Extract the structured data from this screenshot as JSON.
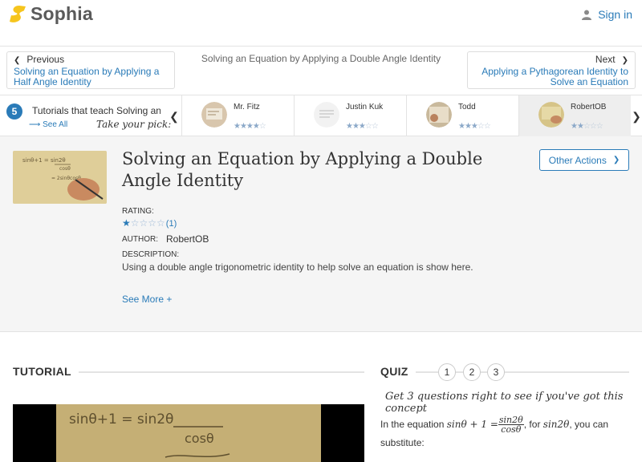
{
  "header": {
    "brand": "Sophia",
    "signin_label": "Sign in"
  },
  "nav": {
    "prev_head": "Previous",
    "prev_link": "Solving an Equation by Applying a Half Angle Identity",
    "current_title": "Solving an Equation by Applying a Double Angle Identity",
    "next_head": "Next",
    "next_link": "Applying a Pythagorean Identity to Solve an Equation"
  },
  "strip": {
    "count": "5",
    "label": "Tutorials that teach Solving an E",
    "see_all": "See All",
    "pick": "Take your pick:",
    "cards": [
      {
        "name": "Mr. Fitz",
        "stars": "3.5"
      },
      {
        "name": "Justin Kuk",
        "stars": "3"
      },
      {
        "name": "Todd",
        "stars": "3"
      },
      {
        "name": "RobertOB",
        "stars": "2"
      }
    ]
  },
  "info": {
    "title": "Solving an Equation by Applying a Double Angle Identity",
    "other_actions": "Other Actions",
    "rating_label": "RATING:",
    "rating_count": "(1)",
    "author_label": "AUTHOR:",
    "author": "RobertOB",
    "description_label": "DESCRIPTION:",
    "description": "Using a double angle trigonometric identity to help solve an equation is show here.",
    "see_more": "See More +"
  },
  "tutorial": {
    "heading": "TUTORIAL",
    "video_line1": "sinθ+1 = sin2θ",
    "video_line2": "cosθ"
  },
  "quiz": {
    "heading": "QUIZ",
    "numbers": [
      "1",
      "2",
      "3"
    ],
    "subtitle": "Get 3 questions right to see if you've got this concept",
    "q_prefix": "In the equation",
    "q_lhs": "sinθ + 1 =",
    "q_frac_num": "sin2θ",
    "q_frac_den": "cosθ",
    "q_mid": ", for",
    "q_term": "sin2θ",
    "q_suffix": ", you can substitute:"
  },
  "colors": {
    "accent": "#2a7bb8",
    "logo_yellow": "#f6c51d",
    "panel_bg": "#f5f5f5"
  }
}
